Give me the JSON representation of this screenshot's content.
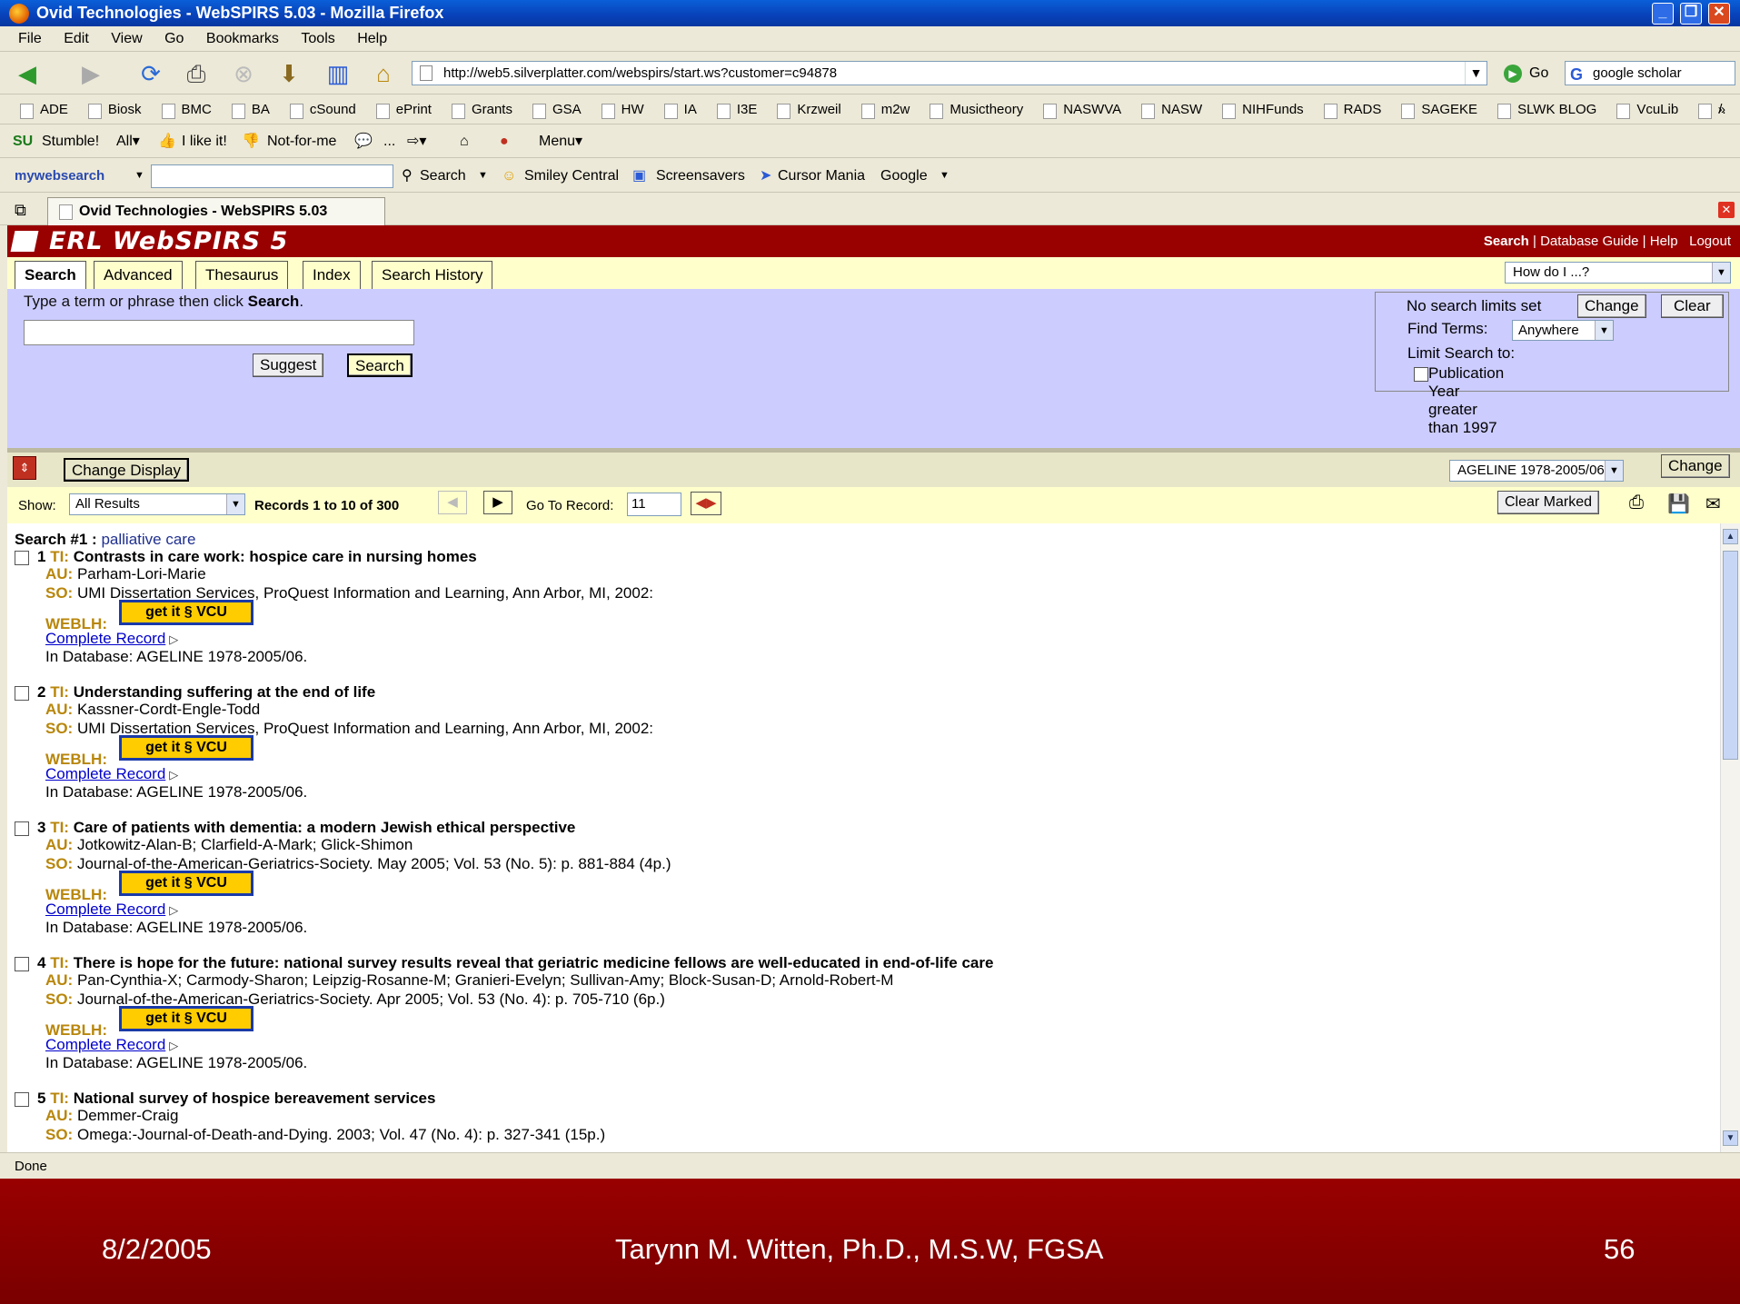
{
  "window": {
    "title": "Ovid Technologies - WebSPIRS 5.03 - Mozilla Firefox"
  },
  "menu": [
    "File",
    "Edit",
    "View",
    "Go",
    "Bookmarks",
    "Tools",
    "Help"
  ],
  "nav": {
    "url": "http://web5.silverplatter.com/webspirs/start.ws?customer=c94878",
    "go_label": "Go",
    "google_search": "google scholar"
  },
  "bookmarks": [
    "ADE",
    "Biosk",
    "BMC",
    "BA",
    "cSound",
    "ePrint",
    "Grants",
    "GSA",
    "HW",
    "IA",
    "I3E",
    "Krzweil",
    "m2w",
    "Musictheory",
    "NASWVA",
    "NASW",
    "NIHFunds",
    "RADS",
    "SAGEKE",
    "SLWK BLOG",
    "VcuLib",
    "/."
  ],
  "stumble": {
    "stumble": "Stumble!",
    "all": "All▾",
    "like": "I like it!",
    "notfor": "Not-for-me",
    "dots": "...",
    "menu": "Menu▾"
  },
  "mywebsearch": {
    "brand": "mywebsearch",
    "search": "Search",
    "smiley": "Smiley Central",
    "screensavers": "Screensavers",
    "cursor": "Cursor Mania",
    "google": "Google"
  },
  "tab": {
    "label": "Ovid Technologies - WebSPIRS 5.03"
  },
  "app": {
    "logo": "ERL WebSPIRS 5",
    "toplinks": {
      "search": "Search",
      "sep1": " | ",
      "guide": "Database Guide",
      "sep2": " | ",
      "help": "Help",
      "logout": "Logout"
    },
    "tabs": [
      "Search",
      "Advanced",
      "Thesaurus",
      "Index",
      "Search History"
    ],
    "howdo": "How do I ...?",
    "hint_pre": "Type a term or phrase then click ",
    "hint_bold": "Search",
    "hint_post": ".",
    "suggest": "Suggest",
    "search_btn": "Search",
    "limits": {
      "status": "No search limits set",
      "change": "Change",
      "clear": "Clear",
      "find_label": "Find Terms:",
      "find_value": "Anywhere",
      "limit_label": "Limit Search to:",
      "pub": "Publication Year greater than 1997"
    },
    "change_display": "Change Display",
    "database": "AGELINE 1978-2005/06",
    "db_change": "Change",
    "show_label": "Show:",
    "show_value": "All Results",
    "records": "Records 1 to 10 of 300",
    "goto_label": "Go To Record:",
    "goto_value": "11",
    "clear_marked": "Clear Marked"
  },
  "results": {
    "search_label": "Search #1 : ",
    "search_term": "palliative care",
    "records": [
      {
        "num": "1",
        "title": "Contrasts in care work: hospice care in nursing homes",
        "au": "Parham-Lori-Marie",
        "so": "UMI Dissertation Services, ProQuest Information and Learning, Ann Arbor, MI, 2002:",
        "db": "In Database: AGELINE 1978-2005/06."
      },
      {
        "num": "2",
        "title": "Understanding suffering at the end of life",
        "au": "Kassner-Cordt-Engle-Todd",
        "so": "UMI Dissertation Services, ProQuest Information and Learning, Ann Arbor, MI, 2002:",
        "db": "In Database: AGELINE 1978-2005/06."
      },
      {
        "num": "3",
        "title": "Care of patients with dementia: a modern Jewish ethical perspective",
        "au": "Jotkowitz-Alan-B; Clarfield-A-Mark; Glick-Shimon",
        "so": "Journal-of-the-American-Geriatrics-Society. May 2005; Vol. 53 (No. 5): p. 881-884 (4p.)",
        "db": "In Database: AGELINE 1978-2005/06."
      },
      {
        "num": "4",
        "title": "There is hope for the future: national survey results reveal that geriatric medicine fellows are well-educated in end-of-life care",
        "au": "Pan-Cynthia-X; Carmody-Sharon; Leipzig-Rosanne-M; Granieri-Evelyn; Sullivan-Amy; Block-Susan-D; Arnold-Robert-M",
        "so": "Journal-of-the-American-Geriatrics-Society. Apr 2005; Vol. 53 (No. 4): p. 705-710 (6p.)",
        "db": "In Database: AGELINE 1978-2005/06."
      },
      {
        "num": "5",
        "title": "National survey of hospice bereavement services",
        "au": "Demmer-Craig",
        "so": "Omega:-Journal-of-Death-and-Dying. 2003; Vol. 47 (No. 4): p. 327-341 (15p.)",
        "db": ""
      }
    ],
    "ti": "TI:",
    "aulab": "AU:",
    "solab": "SO:",
    "weblh": "WEBLH:",
    "getit": "get it § VCU",
    "complete": "Complete Record"
  },
  "status": "Done",
  "footer": {
    "date": "8/2/2005",
    "author": "Tarynn M. Witten, Ph.D., M.S.W, FGSA",
    "page": "56"
  }
}
